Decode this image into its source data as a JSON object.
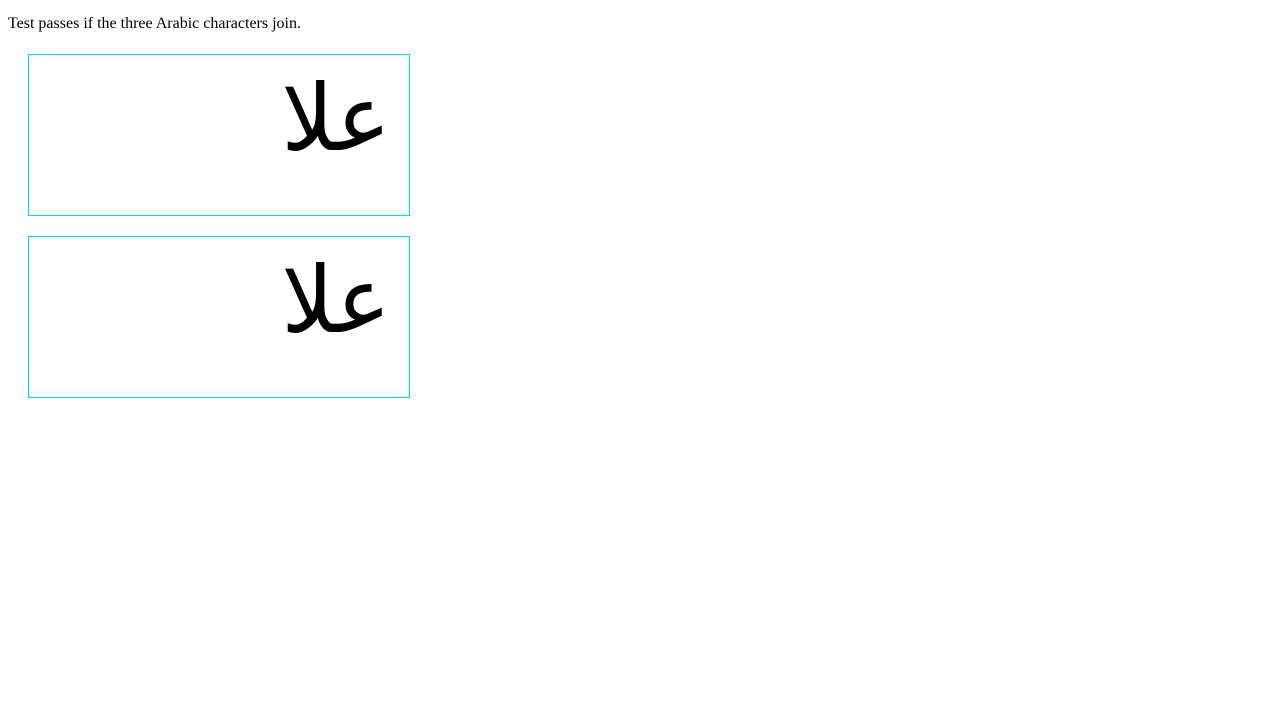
{
  "instruction": "Test passes if the three Arabic characters join.",
  "boxes": [
    {
      "text": "علا"
    },
    {
      "text": "علا"
    }
  ],
  "colors": {
    "box_border": "#00d8f0"
  }
}
